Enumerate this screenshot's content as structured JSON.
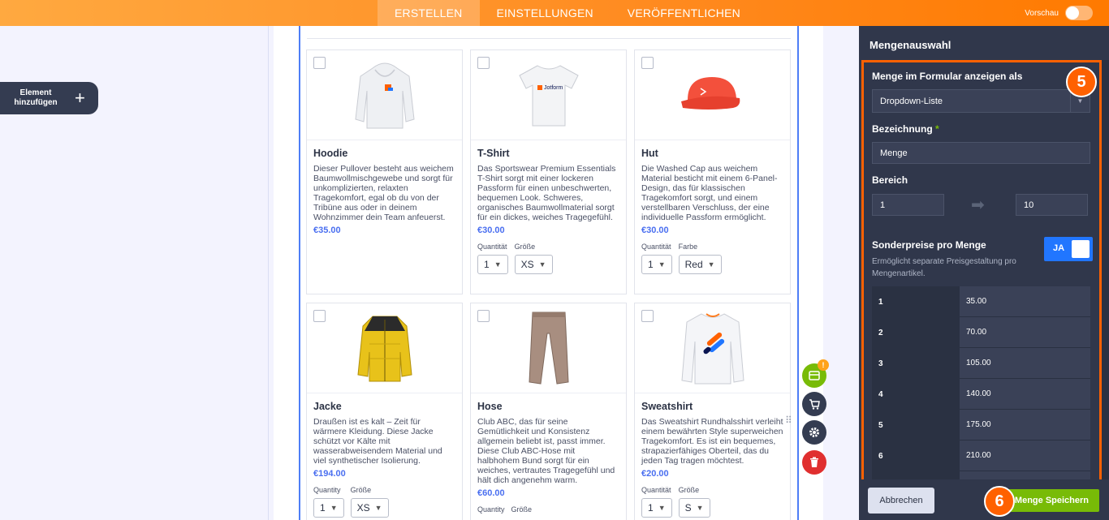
{
  "topbar": {
    "tabs": [
      "ERSTELLEN",
      "EINSTELLUNGEN",
      "VERÖFFENTLICHEN"
    ],
    "active_tab": "ERSTELLEN",
    "preview_label": "Vorschau",
    "colors": {
      "start": "#ffa940",
      "end": "#ff7a00"
    }
  },
  "left_panel": {
    "add_element_label": "Element hinzufügen",
    "add_icon": "plus-icon"
  },
  "products": [
    {
      "title": "Hoodie",
      "desc": "Dieser Pullover besteht aus weichem Baumwollmischgewebe und sorgt für unkomplizierten, relaxten Tragekomfort, egal ob du von der Tribüne aus oder in deinem Wohnzimmer dein Team anfeuerst.",
      "price": "€35.00",
      "icon": "hoodie-image"
    },
    {
      "title": "T-Shirt",
      "desc": "Das Sportswear Premium Essentials T-Shirt sorgt mit einer lockeren Passform für einen unbeschwerten, bequemen Look. Schweres, organisches Baumwollmaterial sorgt für ein dickes, weiches Tragegefühl.",
      "price": "€30.00",
      "icon": "tshirt-image",
      "logo_text": "Jotform",
      "opt1_label": "Quantität",
      "opt1_value": "1",
      "opt2_label": "Größe",
      "opt2_value": "XS"
    },
    {
      "title": "Hut",
      "desc": "Die Washed Cap aus weichem Material besticht mit einem 6-Panel-Design, das für klassischen Tragekomfort sorgt, und einem verstellbaren Verschluss, der eine individuelle Passform ermöglicht.",
      "price": "€30.00",
      "icon": "cap-image",
      "opt1_label": "Quantität",
      "opt1_value": "1",
      "opt2_label": "Farbe",
      "opt2_value": "Red"
    },
    {
      "title": "Jacke",
      "desc": "Draußen ist es kalt – Zeit für wärmere Kleidung. Diese Jacke schützt vor Kälte mit wasserabweisendem Material und viel synthetischer Isolierung.",
      "price": "€194.00",
      "icon": "jacket-image",
      "opt1_label": "Quantity",
      "opt1_value": "1",
      "opt2_label": "Größe",
      "opt2_value": "XS"
    },
    {
      "title": "Hose",
      "desc": "Club ABC, das für seine Gemütlichkeit und Konsistenz allgemein beliebt ist, passt immer. Diese Club ABC-Hose mit halbhohem Bund sorgt für ein weiches, vertrautes Tragegefühl und hält dich angenehm warm.",
      "price": "€60.00",
      "icon": "pants-image",
      "opt1_label": "Quantity",
      "opt2_label": "Größe"
    },
    {
      "title": "Sweatshirt",
      "desc": "Das Sweatshirt Rundhalsshirt verleiht einem bewährten Style superweichen Tragekomfort. Es ist ein bequemes, strapazierfähiges Oberteil, das du jeden Tag tragen möchtest.",
      "price": "€20.00",
      "icon": "sweatshirt-image",
      "opt1_label": "Quantität",
      "opt1_value": "1",
      "opt2_label": "Größe",
      "opt2_value": "S"
    }
  ],
  "tools": {
    "badge": "!",
    "icons": [
      "payment-card-icon",
      "cart-icon",
      "gear-icon",
      "trash-icon"
    ]
  },
  "right_panel": {
    "title": "Mengenauswahl",
    "show_as_label": "Menge im Formular anzeigen als",
    "show_as_value": "Dropdown-Liste",
    "name_label": "Bezeichnung",
    "name_required": "*",
    "name_value": "Menge",
    "range_label": "Bereich",
    "range_from": "1",
    "range_to": "10",
    "special_label": "Sonderpreise pro Menge",
    "special_toggle": "JA",
    "special_hint": "Ermöglicht separate Preisgestaltung pro Mengenartikel.",
    "price_table": [
      {
        "qty": "1",
        "price": "35.00"
      },
      {
        "qty": "2",
        "price": "70.00"
      },
      {
        "qty": "3",
        "price": "105.00"
      },
      {
        "qty": "4",
        "price": "140.00"
      },
      {
        "qty": "5",
        "price": "175.00"
      },
      {
        "qty": "6",
        "price": "210.00"
      }
    ],
    "cancel_label": "Abbrechen",
    "save_label": "Menge Speichern",
    "step_5": "5",
    "step_6": "6",
    "highlight_color": "#ff6100"
  }
}
